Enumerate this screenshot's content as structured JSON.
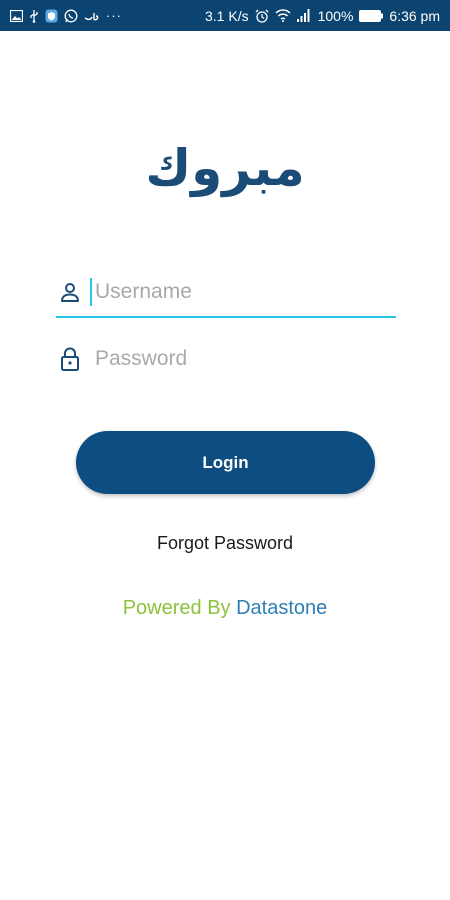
{
  "status_bar": {
    "more_indicator": "···",
    "net_speed": "3.1 K/s",
    "battery_percent": "100%",
    "time": "6:36 pm",
    "icons": [
      "image-icon",
      "usb-icon",
      "shield-icon",
      "whatsapp-icon",
      "arabic-text-icon",
      "alarm-icon",
      "wifi-icon",
      "signal-icon",
      "battery-icon"
    ]
  },
  "logo": {
    "text": "مبروك",
    "color": "#1b4b77"
  },
  "form": {
    "username_placeholder": "Username",
    "password_placeholder": "Password",
    "login_label": "Login",
    "forgot_label": "Forgot Password"
  },
  "footer": {
    "powered_by": "Powered By",
    "brand": "Datastone"
  },
  "colors": {
    "status_bar": "#0b4470",
    "primary": "#0d4d81",
    "focus_accent": "#26c5e8",
    "powered_green": "#8cc23b",
    "brand_blue": "#2f7fb4"
  }
}
